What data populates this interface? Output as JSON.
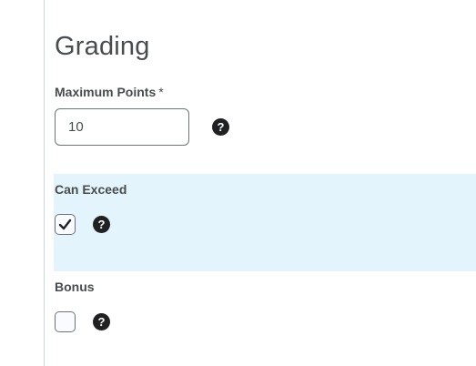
{
  "grading": {
    "title": "Grading",
    "max_points": {
      "label": "Maximum Points",
      "required_marker": "*",
      "value": "10",
      "help_icon": "question-circle-icon"
    },
    "can_exceed": {
      "label": "Can Exceed",
      "checked": true,
      "help_icon": "question-circle-icon",
      "highlight_color": "#e3f4fd"
    },
    "bonus": {
      "label": "Bonus",
      "checked": false,
      "help_icon": "question-circle-icon"
    }
  }
}
